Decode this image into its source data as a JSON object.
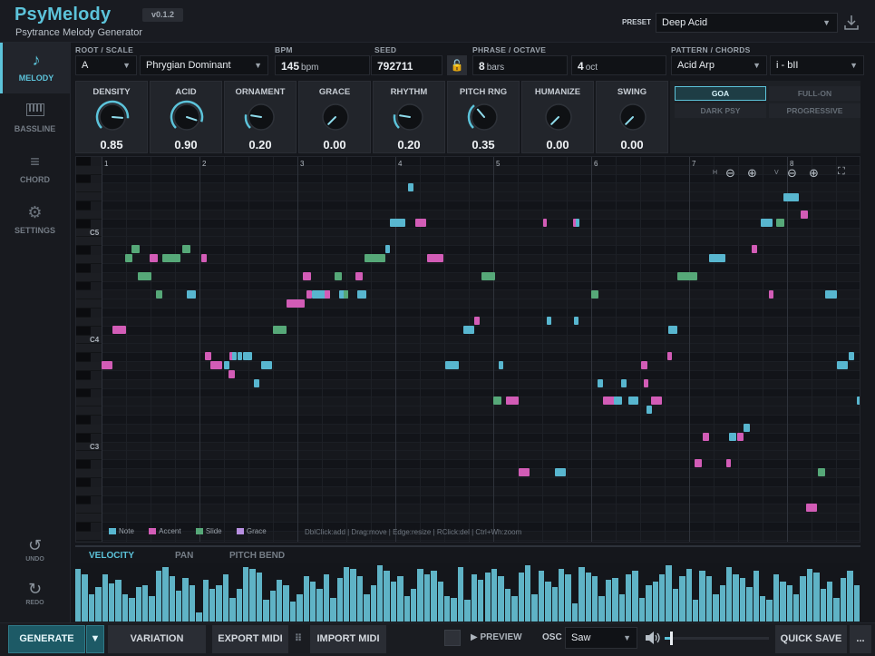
{
  "app": {
    "name": "PsyMelody",
    "subtitle": "Psytrance Melody Generator",
    "version": "v0.1.2"
  },
  "preset": {
    "label": "PRESET",
    "value": "Deep Acid"
  },
  "colors": {
    "accent": "#5cc3da",
    "note": "#58b6cf",
    "accent_note": "#d25cb6",
    "slide": "#56a878",
    "grace": "#b78fe0"
  },
  "sidebar": {
    "items": [
      {
        "label": "MELODY",
        "icon": "music-note-icon",
        "active": true
      },
      {
        "label": "BASSLINE",
        "icon": "piano-keys-icon",
        "active": false
      },
      {
        "label": "CHORD",
        "icon": "stack-icon",
        "active": false
      },
      {
        "label": "SETTINGS",
        "icon": "gear-icon",
        "active": false
      }
    ],
    "undo": "UNDO",
    "redo": "REDO"
  },
  "params": {
    "root_scale_label": "ROOT / SCALE",
    "root": "A",
    "scale": "Phrygian Dominant",
    "bpm_label": "BPM",
    "bpm": "145",
    "bpm_unit": "bpm",
    "seed_label": "SEED",
    "seed": "792711",
    "phrase_label": "PHRASE / OCTAVE",
    "phrase": "8",
    "phrase_unit": "bars",
    "octave": "4",
    "octave_unit": "oct",
    "pattern_label": "PATTERN / CHORDS",
    "pattern": "Acid Arp",
    "chords": "i - bII"
  },
  "knobs": [
    {
      "label": "DENSITY",
      "value": "0.85",
      "level": 0.85
    },
    {
      "label": "ACID",
      "value": "0.90",
      "level": 0.9
    },
    {
      "label": "ORNAMENT",
      "value": "0.20",
      "level": 0.2
    },
    {
      "label": "GRACE",
      "value": "0.00",
      "level": 0.0
    },
    {
      "label": "RHYTHM",
      "value": "0.20",
      "level": 0.2
    },
    {
      "label": "PITCH RNG",
      "value": "0.35",
      "level": 0.35
    },
    {
      "label": "HUMANIZE",
      "value": "0.00",
      "level": 0.0
    },
    {
      "label": "SWING",
      "value": "0.00",
      "level": 0.0
    }
  ],
  "styles": [
    {
      "label": "GOA",
      "active": true
    },
    {
      "label": "FULL-ON",
      "active": false
    },
    {
      "label": "DARK PSY",
      "active": false
    },
    {
      "label": "PROGRESSIVE",
      "active": false
    }
  ],
  "piano_roll": {
    "bars": [
      "1",
      "2",
      "3",
      "4",
      "5",
      "6",
      "7",
      "8"
    ],
    "octave_labels": [
      "C5",
      "C4",
      "C3"
    ],
    "zoom_h_label": "H",
    "zoom_v_label": "V",
    "legend": [
      {
        "label": "Note",
        "color": "#58b6cf"
      },
      {
        "label": "Accent",
        "color": "#d25cb6"
      },
      {
        "label": "Slide",
        "color": "#56a878"
      },
      {
        "label": "Grace",
        "color": "#b78fe0"
      }
    ],
    "hint": "DblClick:add | Drag:move | Edge:resize | RClick:del | Ctrl+Wh:zoom"
  },
  "lower_tabs": [
    "VELOCITY",
    "PAN",
    "PITCH BEND"
  ],
  "bottom": {
    "generate": "GENERATE",
    "variation": "VARIATION",
    "export": "EXPORT MIDI",
    "import": "IMPORT MIDI",
    "preview": "PREVIEW",
    "osc_label": "OSC",
    "osc": "Saw",
    "volume": 0.05,
    "quick_save": "QUICK SAVE",
    "more": "..."
  }
}
